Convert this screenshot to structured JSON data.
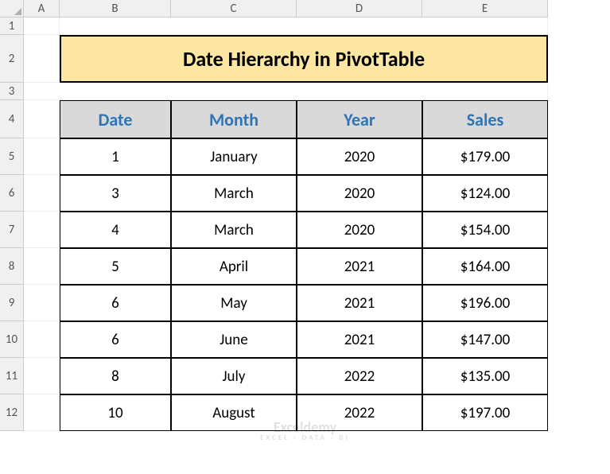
{
  "columns": [
    "A",
    "B",
    "C",
    "D",
    "E"
  ],
  "rows": [
    "1",
    "2",
    "3",
    "4",
    "5",
    "6",
    "7",
    "8",
    "9",
    "10",
    "11",
    "12"
  ],
  "title": "Date Hierarchy in PivotTable",
  "headers": {
    "date": "Date",
    "month": "Month",
    "year": "Year",
    "sales": "Sales"
  },
  "data": [
    {
      "date": "1",
      "month": "January",
      "year": "2020",
      "sales": "$179.00"
    },
    {
      "date": "3",
      "month": "March",
      "year": "2020",
      "sales": "$124.00"
    },
    {
      "date": "4",
      "month": "March",
      "year": "2020",
      "sales": "$154.00"
    },
    {
      "date": "5",
      "month": "April",
      "year": "2021",
      "sales": "$164.00"
    },
    {
      "date": "6",
      "month": "May",
      "year": "2021",
      "sales": "$196.00"
    },
    {
      "date": "6",
      "month": "June",
      "year": "2021",
      "sales": "$147.00"
    },
    {
      "date": "8",
      "month": "July",
      "year": "2022",
      "sales": "$135.00"
    },
    {
      "date": "10",
      "month": "August",
      "year": "2022",
      "sales": "$197.00"
    }
  ],
  "watermark": {
    "brand": "Exceldemy",
    "tagline": "EXCEL · DATA · BI"
  },
  "chart_data": {
    "type": "table",
    "title": "Date Hierarchy in PivotTable",
    "columns": [
      "Date",
      "Month",
      "Year",
      "Sales"
    ],
    "rows": [
      [
        1,
        "January",
        2020,
        179.0
      ],
      [
        3,
        "March",
        2020,
        124.0
      ],
      [
        4,
        "March",
        2020,
        154.0
      ],
      [
        5,
        "April",
        2021,
        164.0
      ],
      [
        6,
        "May",
        2021,
        196.0
      ],
      [
        6,
        "June",
        2021,
        147.0
      ],
      [
        8,
        "July",
        2022,
        135.0
      ],
      [
        10,
        "August",
        2022,
        197.0
      ]
    ]
  }
}
